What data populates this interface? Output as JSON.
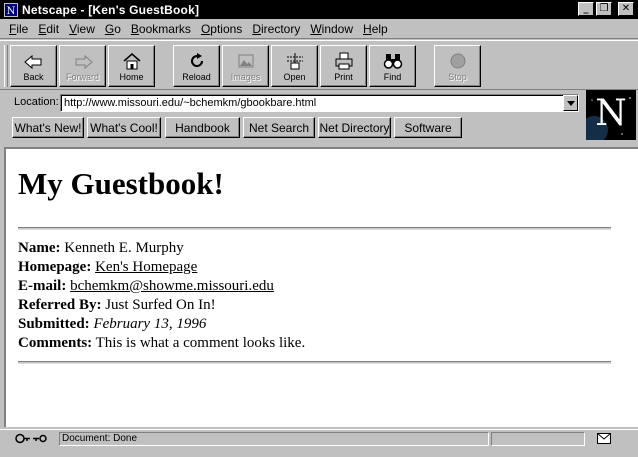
{
  "window": {
    "title": "Netscape - [Ken's GuestBook]",
    "controls": {
      "minimize": "_",
      "restore": "❐",
      "close": "✕"
    }
  },
  "menubar": [
    {
      "label": "File",
      "accel": "F",
      "rest": "ile"
    },
    {
      "label": "Edit",
      "accel": "E",
      "rest": "dit"
    },
    {
      "label": "View",
      "accel": "V",
      "rest": "iew"
    },
    {
      "label": "Go",
      "accel": "G",
      "rest": "o"
    },
    {
      "label": "Bookmarks",
      "accel": "B",
      "rest": "ookmarks"
    },
    {
      "label": "Options",
      "accel": "O",
      "rest": "ptions"
    },
    {
      "label": "Directory",
      "accel": "D",
      "rest": "irectory"
    },
    {
      "label": "Window",
      "accel": "W",
      "rest": "indow"
    },
    {
      "label": "Help",
      "accel": "H",
      "rest": "elp"
    }
  ],
  "toolbar": {
    "back": {
      "label": "Back",
      "icon": "back-arrow-icon",
      "enabled": true
    },
    "forward": {
      "label": "Forward",
      "icon": "forward-arrow-icon",
      "enabled": false
    },
    "home": {
      "label": "Home",
      "icon": "house-icon",
      "enabled": true
    },
    "reload": {
      "label": "Reload",
      "icon": "reload-icon",
      "enabled": true
    },
    "images": {
      "label": "Images",
      "icon": "images-icon",
      "enabled": false
    },
    "open": {
      "label": "Open",
      "icon": "open-icon",
      "enabled": true
    },
    "print": {
      "label": "Print",
      "icon": "printer-icon",
      "enabled": true
    },
    "find": {
      "label": "Find",
      "icon": "binoculars-icon",
      "enabled": true
    },
    "stop": {
      "label": "Stop",
      "icon": "stop-icon",
      "enabled": false
    }
  },
  "location": {
    "label": "Location:",
    "url": "http://www.missouri.edu/~bchemkm/gbookbare.html"
  },
  "directory_buttons": [
    "What's New!",
    "What's Cool!",
    "Handbook",
    "Net Search",
    "Net Directory",
    "Software"
  ],
  "logo": {
    "letter": "N"
  },
  "page": {
    "heading": "My Guestbook!",
    "fields": {
      "name": {
        "key": "Name:",
        "value": "Kenneth E. Murphy"
      },
      "homepage": {
        "key": "Homepage:",
        "value": "Ken's Homepage"
      },
      "email": {
        "key": "E-mail:",
        "value": "bchemkm@showme.missouri.edu"
      },
      "referred": {
        "key": "Referred By:",
        "value": "Just Surfed On In!"
      },
      "submitted": {
        "key": "Submitted:",
        "value": "February 13, 1996"
      },
      "comments": {
        "key": "Comments:",
        "value": "This is what a comment looks like."
      }
    }
  },
  "status": {
    "text": "Document: Done",
    "icons": {
      "security": "broken-key-icon",
      "mail": "envelope-icon"
    }
  },
  "colors": {
    "chrome": "#c0c0c0",
    "titlebar": "#000000",
    "content_bg": "#ffffff"
  }
}
